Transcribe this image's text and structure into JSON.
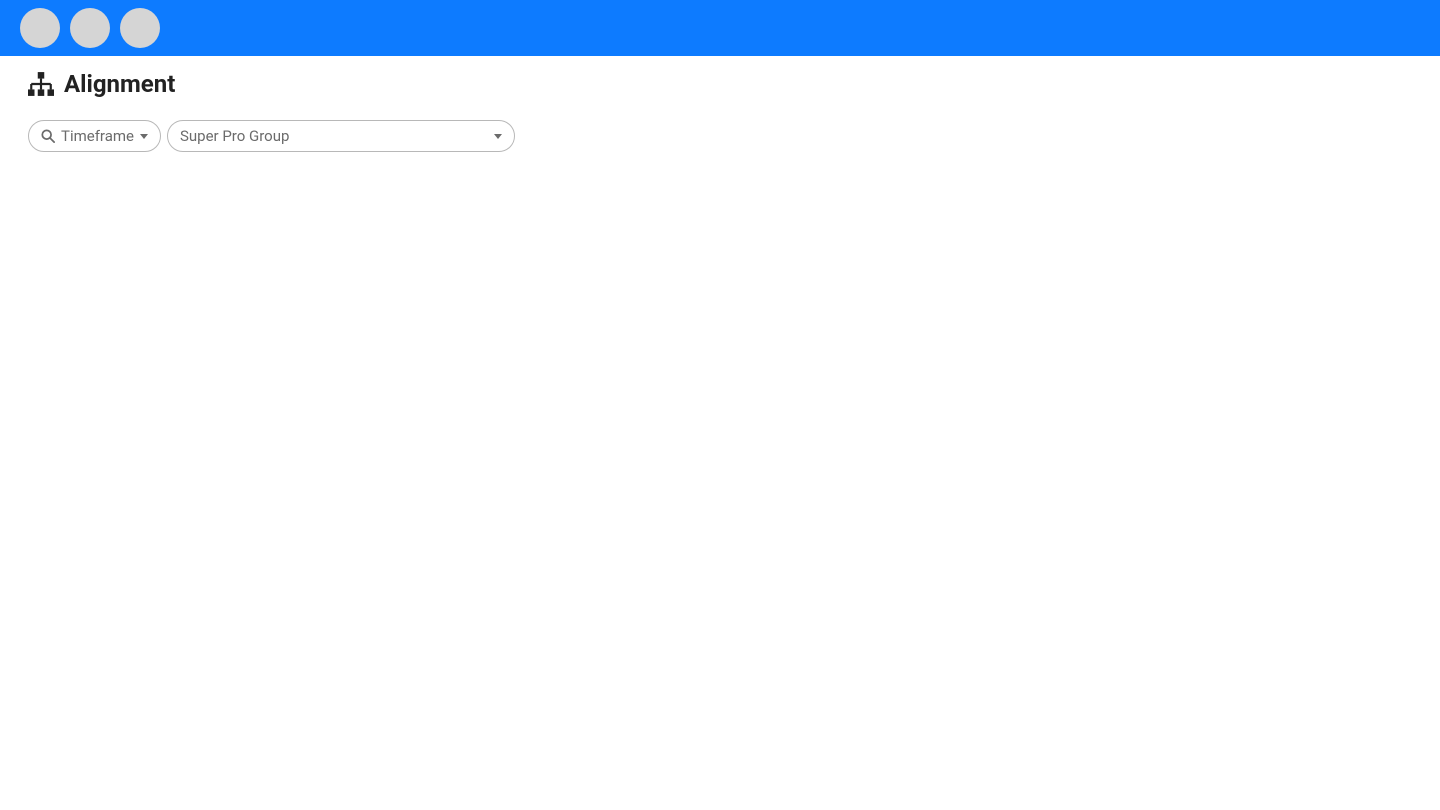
{
  "header": {
    "title": "Alignment"
  },
  "filters": {
    "timeframe_label": "Timeframe",
    "group_selected": "Super Pro Group"
  }
}
